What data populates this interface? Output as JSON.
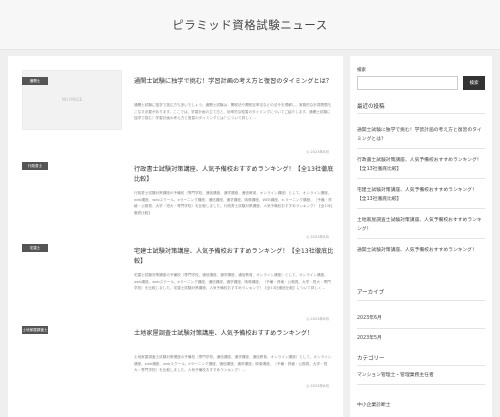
{
  "site": {
    "title": "ピラミッド資格試験ニュース"
  },
  "posts": [
    {
      "category": "通関士",
      "has_thumb": true,
      "thumb_label": "NO IMAGE",
      "title": "通関士試験に独学で挑む！学習計画の考え方と復習のタイミングとは？",
      "excerpt": "通関士試験に独学で挑む方も多いでしょう。通関士試験は、関税法や関税定率法などの法令を理解し、実務的な計算問題もこなす必要があります。ここでは、学習計画の立て方と、効率的な復習のタイミングについてご紹介します。通関士試験に独学で挑む！学習計画の考え方と復習のタイミングとは？について詳しく…",
      "date": "2023年6月"
    },
    {
      "category": "行政書士",
      "has_thumb": false,
      "title": "行政書士試験対策講座、人気予備校おすすめランキング！【全13社徹底比較】",
      "excerpt": "行政書士試験対策講座の予備校（専門学校、通信講座、通学講座、通信教育、オンライン講座）として、オンライン講座、web講座、webスクール、eラーニング講座、通信講座、通学講座、映像講座、WEB講座、e-ラーニング講座、（予備・資格・公務員、大学・短大・専門学校）を比較しました。行政書士試験対策講座、人気予備校おすすめランキング！【全13社徹底比較】",
      "date": "2023年6月"
    },
    {
      "category": "宅建士",
      "has_thumb": false,
      "title": "宅建士試験対策講座、人気予備校おすすめランキング！【全13社徹底比較】",
      "excerpt": "宅建士試験対策講座の予備校（専門学校、通信講座、通学講座、通信教育、オンライン講座）として、オンライン講座、web講座、webスクール、eラーニング講座、通信講座、通学講座、映像講座、（予備・資格・公務員、大学・短大・専門学校）を比較しました。宅建士試験対策講座、人気予備校おすすめランキング！【全13社徹底比較】について詳しく…",
      "date": "2023年6月"
    },
    {
      "category": "土地家屋調査士",
      "has_thumb": false,
      "title": "土地家屋調査士試験対策講座、人気予備校おすすめランキング！",
      "excerpt": "土地家屋調査士試験対策講座の予備校（専門学校、通信講座、通学講座、通信教育、オンライン講座）として、オンライン講座、web講座、webスクール、eラーニング講座、通信講座、通学講座、映像講座、（予備・資格・公務員、大学・短大・専門学校）を比較しました。人気予備校おすすめランキング！…",
      "date": "2023年6月"
    }
  ],
  "sidebar": {
    "search": {
      "label": "検索",
      "button": "検索",
      "placeholder": ""
    },
    "recent": {
      "title": "最近の投稿",
      "items": [
        "通関士試験に独学で挑む！学習計画の考え方と復習のタイミングとは？",
        "行政書士試験対策講座、人気予備校おすすめランキング！【全13社徹底比較】",
        "宅建士試験対策講座、人気予備校おすすめランキング！【全13社徹底比較】",
        "土地家屋調査士試験対策講座、人気予備校おすすめランキング！",
        "通関士試験対策講座、人気予備校おすすめランキング！"
      ]
    },
    "archive": {
      "title": "アーカイブ",
      "items": [
        "2023年6月",
        "2023年5月"
      ]
    },
    "categories": {
      "title": "カテゴリー",
      "items": [
        "マンション管理士・管理業務主任者",
        "中小企業診断士"
      ]
    }
  }
}
